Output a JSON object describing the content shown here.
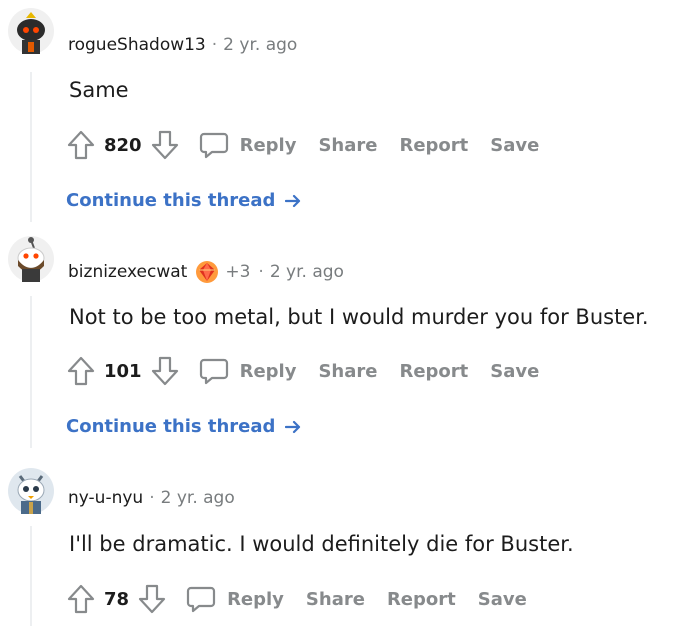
{
  "comments": [
    {
      "username": "rogueShadow13",
      "separator": "·",
      "time": "2 yr. ago",
      "body": "Same",
      "score": "820",
      "avatar_icon": "snoo-avatar-icon",
      "continue_label": "Continue this thread"
    },
    {
      "username": "biznizexecwat",
      "flair_count": "+3",
      "separator": "·",
      "time": "2 yr. ago",
      "body": "Not to be too metal, but I would murder you for Buster.",
      "score": "101",
      "avatar_icon": "snoo-avatar-icon",
      "award_icon": "award-gem-icon",
      "continue_label": "Continue this thread"
    },
    {
      "username": "ny-u-nyu",
      "separator": "·",
      "time": "2 yr. ago",
      "body": "I'll be dramatic. I would definitely die for Buster.",
      "score": "78",
      "avatar_icon": "snoo-avatar-icon"
    }
  ],
  "actions": {
    "reply": "Reply",
    "share": "Share",
    "report": "Report",
    "save": "Save"
  },
  "colors": {
    "link": "#3c72c6",
    "muted": "#878a8c",
    "thread_line": "#edeff1"
  }
}
